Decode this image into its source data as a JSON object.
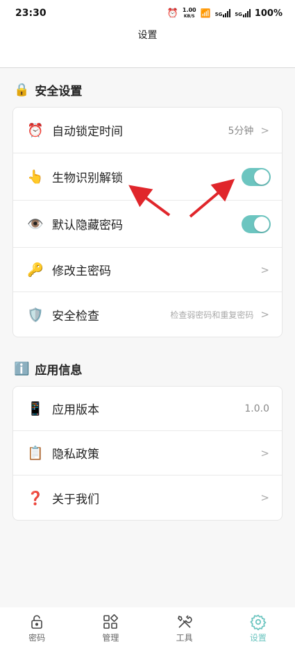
{
  "status_bar": {
    "time": "23:30",
    "speed_value": "1.00",
    "speed_unit": "KB/S",
    "battery": "100%",
    "signal_1": "5G",
    "signal_2": "5G"
  },
  "header": {
    "title": "设置"
  },
  "security_section": {
    "emoji": "🔒",
    "title": "安全设置",
    "items": [
      {
        "emoji": "⏰",
        "label": "自动锁定时间",
        "value": "5分钟",
        "chevron": ">"
      },
      {
        "emoji": "👆",
        "label": "生物识别解锁",
        "toggle": true
      },
      {
        "emoji": "👁️",
        "label": "默认隐藏密码",
        "toggle": true
      },
      {
        "emoji": "🔑",
        "label": "修改主密码",
        "chevron": ">"
      },
      {
        "emoji": "🛡️",
        "label": "安全检查",
        "value": "检查弱密码和重复密码",
        "chevron": ">"
      }
    ]
  },
  "info_section": {
    "emoji": "ℹ️",
    "title": "应用信息",
    "items": [
      {
        "emoji": "📱",
        "label": "应用版本",
        "value": "1.0.0"
      },
      {
        "emoji": "📋",
        "label": "隐私政策",
        "chevron": ">"
      },
      {
        "emoji": "❓",
        "label": "关于我们",
        "chevron": ">"
      }
    ]
  },
  "tabbar": {
    "tabs": [
      {
        "label": "密码",
        "icon": "lock-icon",
        "active": false
      },
      {
        "label": "管理",
        "icon": "grid-icon",
        "active": false
      },
      {
        "label": "工具",
        "icon": "tools-icon",
        "active": false
      },
      {
        "label": "设置",
        "icon": "gear-icon",
        "active": true
      }
    ]
  },
  "colors": {
    "accent": "#6cc5c0",
    "annotation_arrow": "#e0262b"
  }
}
